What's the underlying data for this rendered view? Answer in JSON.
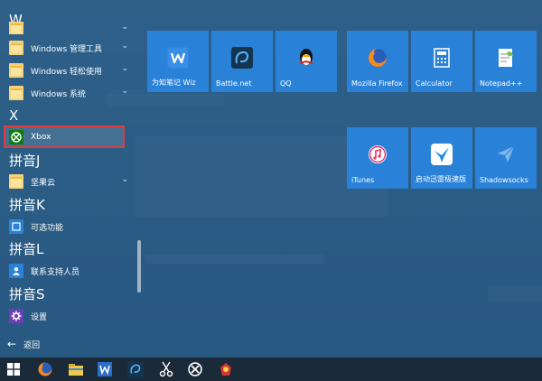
{
  "app_list": {
    "sections": [
      {
        "letter": "W",
        "items": [
          {
            "label": "",
            "icon": "folder-icon",
            "has_chevron": true
          },
          {
            "label": "Windows 管理工具",
            "icon": "folder-icon",
            "has_chevron": true
          },
          {
            "label": "Windows 轻松使用",
            "icon": "folder-icon",
            "has_chevron": true
          },
          {
            "label": "Windows 系统",
            "icon": "folder-icon",
            "has_chevron": true
          }
        ]
      },
      {
        "letter": "X",
        "items": [
          {
            "label": "Xbox",
            "icon": "xbox-icon",
            "has_chevron": false,
            "highlighted": true
          }
        ]
      },
      {
        "letter": "拼音J",
        "items": [
          {
            "label": "坚果云",
            "icon": "folder-icon",
            "has_chevron": true
          }
        ]
      },
      {
        "letter": "拼音K",
        "items": [
          {
            "label": "可选功能",
            "icon": "optional-features-icon",
            "has_chevron": false
          }
        ]
      },
      {
        "letter": "拼音L",
        "items": [
          {
            "label": "联系支持人员",
            "icon": "contact-support-icon",
            "has_chevron": false
          }
        ]
      },
      {
        "letter": "拼音S",
        "items": [
          {
            "label": "设置",
            "icon": "settings-gear-icon",
            "has_chevron": false
          }
        ]
      }
    ],
    "back_label": "返回"
  },
  "tiles": {
    "group1": [
      {
        "label": "为知笔记 Wiz",
        "icon": "wiz-icon"
      },
      {
        "label": "Battle.net",
        "icon": "battlenet-icon"
      },
      {
        "label": "QQ",
        "icon": "qq-penguin-icon"
      }
    ],
    "group2_row1": [
      {
        "label": "Mozilla Firefox",
        "icon": "firefox-icon"
      },
      {
        "label": "Calculator",
        "icon": "calculator-icon"
      },
      {
        "label": "Notepad++",
        "icon": "notepadpp-icon"
      }
    ],
    "group2_row2": [
      {
        "label": "iTunes",
        "icon": "itunes-icon"
      },
      {
        "label": "启动迅雷极速版",
        "icon": "xunlei-icon"
      },
      {
        "label": "Shadowsocks",
        "icon": "shadowsocks-icon"
      }
    ]
  },
  "taskbar": {
    "items": [
      "start-windows-icon",
      "firefox-icon",
      "file-explorer-icon",
      "wps-writer-icon",
      "battlenet-icon",
      "scissors-tool-icon",
      "xbox-icon",
      "app-icon"
    ]
  },
  "colors": {
    "tile_blue": "#2a82d8",
    "xbox_green": "#107c10",
    "highlight_red": "#e03a3a",
    "taskbar": "#1b2a38"
  }
}
